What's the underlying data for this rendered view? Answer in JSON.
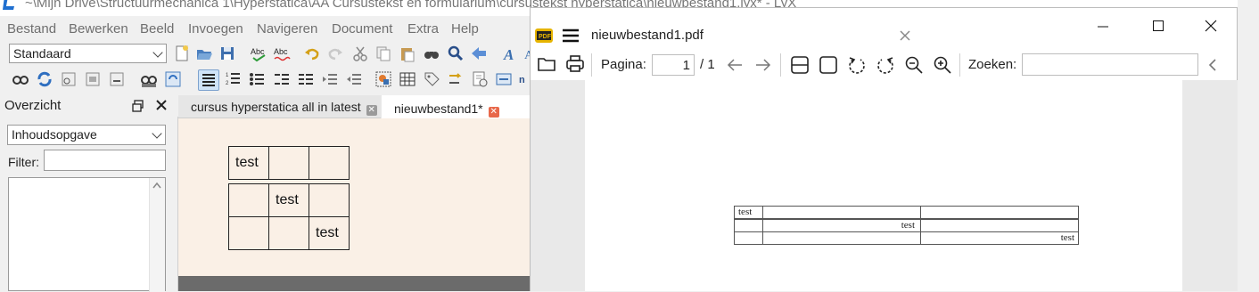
{
  "window": {
    "title": "~\\Mijn Drive\\Structuurmechanica 1\\Hyperstatica\\AA Cursustekst en formularium\\cursustekst hyperstatica\\nieuwbestand1.lyx* - LyX"
  },
  "menu": [
    "Bestand",
    "Bewerken",
    "Beeld",
    "Invoegen",
    "Navigeren",
    "Document",
    "Extra",
    "Help"
  ],
  "toolbar": {
    "style_combo": "Standaard"
  },
  "overview": {
    "title": "Overzicht",
    "type_combo": "Inhoudsopgave",
    "filter_label": "Filter:",
    "filter_value": ""
  },
  "tabs": [
    {
      "label": "cursus hyperstatica all in latest",
      "active": false
    },
    {
      "label": "nieuwbestand1*",
      "active": true
    }
  ],
  "editor_table": {
    "rows": [
      [
        "test",
        "",
        ""
      ],
      [
        "",
        "test",
        ""
      ],
      [
        "",
        "",
        "test"
      ]
    ]
  },
  "pdf_viewer": {
    "title": "nieuwbestand1.pdf",
    "page_label": "Pagina:",
    "page_current": "1",
    "page_total": "/ 1",
    "search_label": "Zoeken:",
    "search_value": "",
    "table_rows": [
      [
        "test",
        "",
        ""
      ],
      [
        "",
        "test",
        ""
      ],
      [
        "",
        "",
        "test"
      ]
    ]
  },
  "colors": {
    "editor_bg": "#faf0e6",
    "tab_close_active": "#e8684a",
    "selection": "#cfe3f7"
  }
}
